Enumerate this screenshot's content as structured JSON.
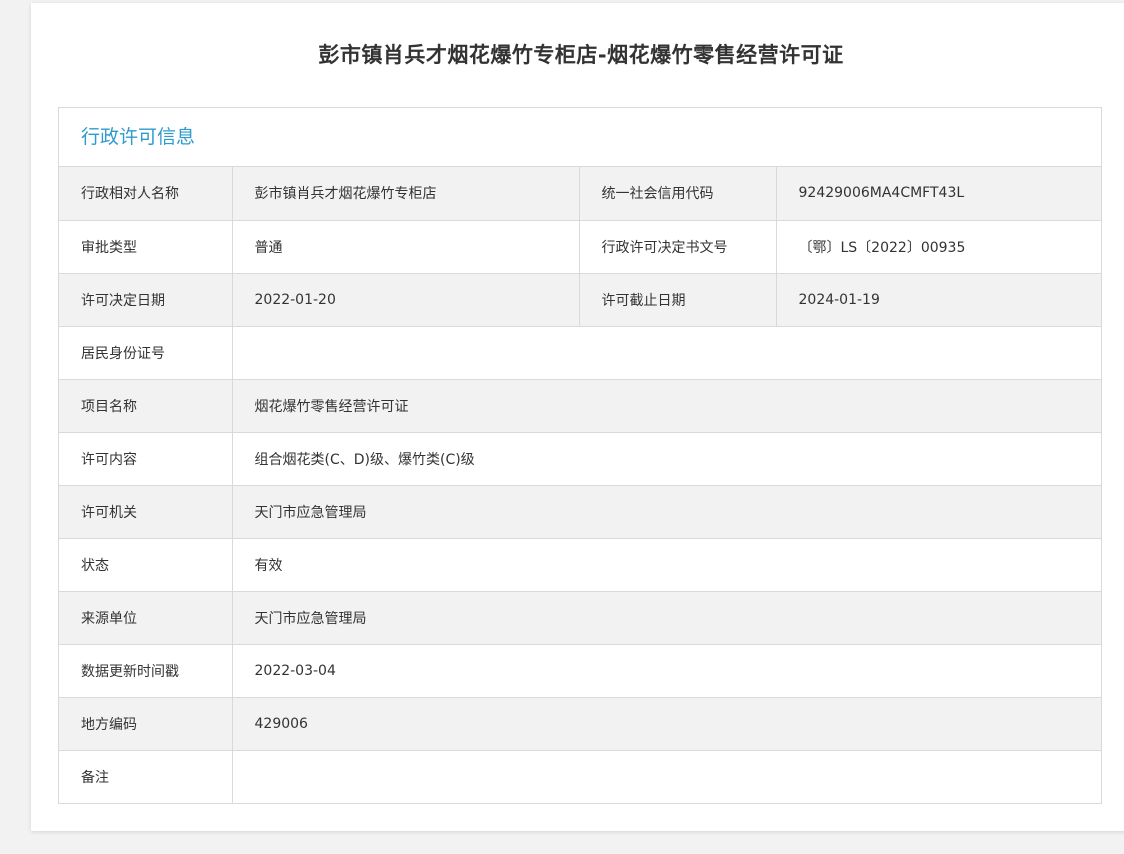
{
  "page": {
    "title": "彭市镇肖兵才烟花爆竹专柜店-烟花爆竹零售经营许可证"
  },
  "section": {
    "title": "行政许可信息"
  },
  "fields": {
    "counterparty_name": {
      "label": "行政相对人名称",
      "value": "彭市镇肖兵才烟花爆竹专柜店"
    },
    "credit_code": {
      "label": "统一社会信用代码",
      "value": "92429006MA4CMFT43L"
    },
    "approval_type": {
      "label": "审批类型",
      "value": "普通"
    },
    "decision_doc_no": {
      "label": "行政许可决定书文号",
      "value": "〔鄂〕LS〔2022〕00935"
    },
    "decision_date": {
      "label": "许可决定日期",
      "value": "2022-01-20"
    },
    "expiry_date": {
      "label": "许可截止日期",
      "value": "2024-01-19"
    },
    "resident_id": {
      "label": "居民身份证号",
      "value": ""
    },
    "project_name": {
      "label": "项目名称",
      "value": "烟花爆竹零售经营许可证"
    },
    "permit_content": {
      "label": "许可内容",
      "value": "组合烟花类(C、D)级、爆竹类(C)级"
    },
    "permit_authority": {
      "label": "许可机关",
      "value": "天门市应急管理局"
    },
    "status": {
      "label": "状态",
      "value": "有效"
    },
    "source_unit": {
      "label": "来源单位",
      "value": "天门市应急管理局"
    },
    "data_update": {
      "label": "数据更新时间戳",
      "value": "2022-03-04"
    },
    "region_code": {
      "label": "地方编码",
      "value": "429006"
    },
    "remarks": {
      "label": "备注",
      "value": ""
    }
  },
  "colors": {
    "section_title": "#2d9bcf",
    "shaded_row": "#f2f2f2",
    "border": "#d9d9d9"
  }
}
